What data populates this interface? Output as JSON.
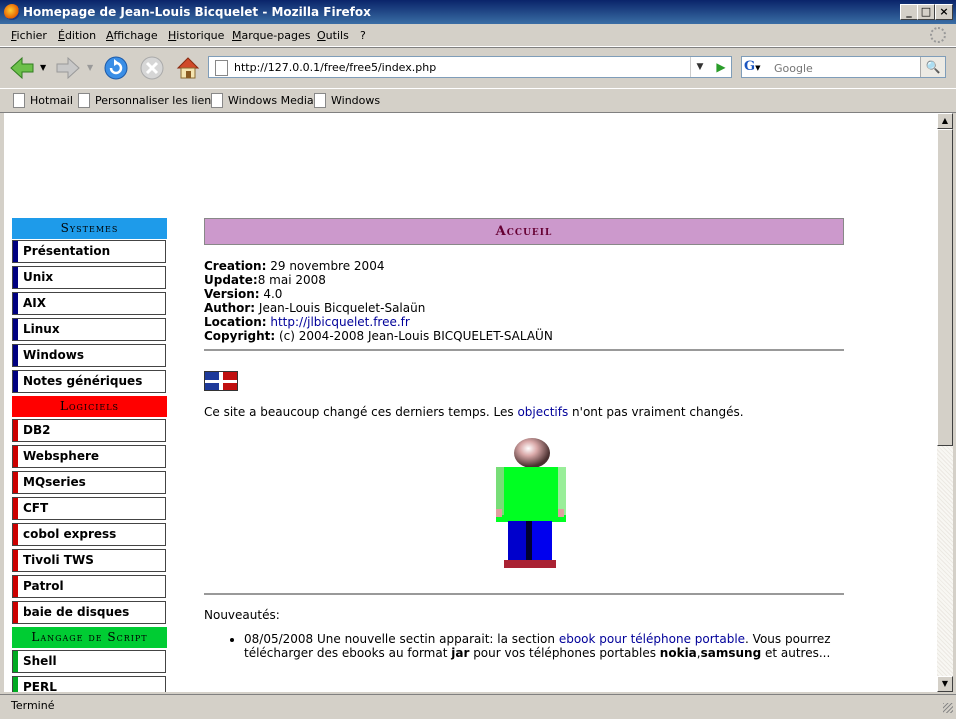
{
  "window": {
    "title": "Homepage de Jean-Louis Bicquelet - Mozilla Firefox",
    "minimize": "_",
    "maximize": "□",
    "close": "×"
  },
  "menu": [
    "Fichier",
    "Édition",
    "Affichage",
    "Historique",
    "Marque-pages",
    "Outils",
    "?"
  ],
  "nav": {
    "url": "http://127.0.0.1/free/free5/index.php",
    "search_placeholder": "Google"
  },
  "bookmarks": [
    "Hotmail",
    "Personnaliser les liens",
    "Windows Media",
    "Windows"
  ],
  "sidebar": {
    "systemes_header": "Systemes",
    "systemes": [
      "Présentation",
      "Unix",
      "AIX",
      "Linux",
      "Windows",
      "Notes génériques"
    ],
    "logiciels_header": "Logiciels",
    "logiciels": [
      "DB2",
      "Websphere",
      "MQseries",
      "CFT",
      "cobol express",
      "Tivoli TWS",
      "Patrol",
      "baie de disques"
    ],
    "script_header": "Langage de Script",
    "script": [
      "Shell",
      "PERL"
    ],
    "colors": {
      "systemes": "#1e9bea",
      "logiciels": "#ff0000",
      "script": "#00cc33",
      "systemes_bar": "#000080",
      "logiciels_bar": "#cc0000",
      "script_bar": "#00aa22"
    }
  },
  "main": {
    "heading": "Accueil",
    "creation_label": "Creation:",
    "creation_value": "29 novembre 2004",
    "update_label": "Update:",
    "update_value": "8 mai 2008",
    "version_label": "Version:",
    "version_value": "4.0",
    "author_label": "Author:",
    "author_value": "Jean-Louis Bicquelet-Salaün",
    "location_label": "Location:",
    "location_value": "http://jlbicquelet.free.fr",
    "copyright_label": "Copyright:",
    "copyright_value": "(c) 2004-2008 Jean-Louis BICQUELET-SALAÜN",
    "intro_before": "Ce site a beaucoup changé ces derniers temps. Les ",
    "intro_link": "objectifs",
    "intro_after": " n'ont pas vraiment changés.",
    "news_title": "Nouveautés:",
    "news1_a": "08/05/2008 Une nouvelle sectin apparait: la section ",
    "news1_link": "ebook pour téléphone portable",
    "news1_b": ". Vous pourrez télécharger des ebooks au format ",
    "news1_jar": "jar",
    "news1_c": " pour vos téléphones portables ",
    "news1_nokia": "nokia",
    "news1_comma": ",",
    "news1_samsung": "samsung",
    "news1_d": " et autres..."
  },
  "status": "Terminé"
}
